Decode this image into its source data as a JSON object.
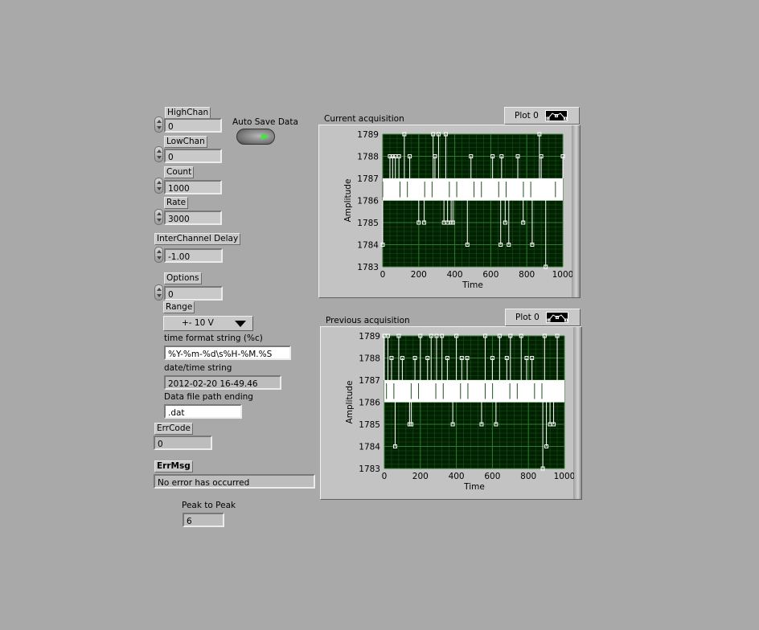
{
  "controls": {
    "high_chan": {
      "label": "HighChan",
      "value": "0"
    },
    "low_chan": {
      "label": "LowChan",
      "value": "0"
    },
    "count": {
      "label": "Count",
      "value": "1000"
    },
    "rate": {
      "label": "Rate",
      "value": "3000"
    },
    "interchannel_delay": {
      "label": "InterChannel Delay",
      "value": "-1.00"
    },
    "options": {
      "label": "Options",
      "value": "0"
    },
    "range": {
      "label": "Range",
      "value": "+- 10 V"
    },
    "time_format": {
      "label": "time format string (%c)",
      "value": "%Y-%m-%d\\s%H-%M.%S"
    },
    "datetime": {
      "label": "date/time string",
      "value": "2012-02-20 16-49.46"
    },
    "data_file_path": {
      "label": "Data file path ending",
      "value": ".dat"
    },
    "err_code": {
      "label": "ErrCode",
      "value": "0"
    },
    "err_msg": {
      "label": "ErrMsg",
      "value": "No error has occurred"
    },
    "peak_to_peak": {
      "label": "Peak to Peak",
      "value": "6"
    },
    "auto_save": {
      "label": "Auto Save Data",
      "state": "on",
      "led_color": "#3fe83f"
    }
  },
  "colors": {
    "panel_bg": "#a9a9a9",
    "plot_bg": "#002200",
    "grid": "#2f7a2f",
    "trace": "#ffffff"
  },
  "chart_data": [
    {
      "type": "line",
      "title": "Current acquisition",
      "xlabel": "Time",
      "ylabel": "Amplitude",
      "legend": "Plot 0",
      "xlim": [
        0,
        1000
      ],
      "ylim": [
        1783,
        1789
      ],
      "x_ticks": [
        "0",
        "200",
        "400",
        "600",
        "800",
        "1000"
      ],
      "y_ticks": [
        "1789",
        "1788",
        "1787",
        "1786",
        "1785",
        "1784",
        "1783"
      ],
      "series": [
        {
          "name": "Plot 0",
          "markers": [
            [
              0,
              1784
            ],
            [
              40,
              1788
            ],
            [
              55,
              1788
            ],
            [
              70,
              1788
            ],
            [
              90,
              1788
            ],
            [
              120,
              1789
            ],
            [
              150,
              1788
            ],
            [
              200,
              1785
            ],
            [
              230,
              1785
            ],
            [
              280,
              1789
            ],
            [
              290,
              1788
            ],
            [
              310,
              1789
            ],
            [
              340,
              1785
            ],
            [
              350,
              1789
            ],
            [
              360,
              1785
            ],
            [
              380,
              1785
            ],
            [
              390,
              1785
            ],
            [
              470,
              1784
            ],
            [
              490,
              1788
            ],
            [
              610,
              1788
            ],
            [
              655,
              1784
            ],
            [
              660,
              1788
            ],
            [
              680,
              1785
            ],
            [
              700,
              1784
            ],
            [
              750,
              1788
            ],
            [
              780,
              1785
            ],
            [
              830,
              1784
            ],
            [
              870,
              1789
            ],
            [
              880,
              1788
            ],
            [
              905,
              1783
            ],
            [
              1000,
              1788
            ]
          ],
          "band": {
            "y_low": 1786,
            "y_high": 1787,
            "x_from": 0,
            "x_to": 1000
          }
        }
      ]
    },
    {
      "type": "line",
      "title": "Previous acquisition",
      "xlabel": "Time",
      "ylabel": "Amplitude",
      "legend": "Plot 0",
      "xlim": [
        0,
        1000
      ],
      "ylim": [
        1783,
        1789
      ],
      "x_ticks": [
        "0",
        "200",
        "400",
        "600",
        "800",
        "1000"
      ],
      "y_ticks": [
        "1789",
        "1788",
        "1787",
        "1786",
        "1785",
        "1784",
        "1783"
      ],
      "series": [
        {
          "name": "Plot 0",
          "markers": [
            [
              0,
              1789
            ],
            [
              20,
              1789
            ],
            [
              40,
              1788
            ],
            [
              60,
              1784
            ],
            [
              80,
              1789
            ],
            [
              100,
              1788
            ],
            [
              140,
              1785
            ],
            [
              150,
              1785
            ],
            [
              170,
              1788
            ],
            [
              200,
              1789
            ],
            [
              240,
              1788
            ],
            [
              260,
              1789
            ],
            [
              290,
              1789
            ],
            [
              320,
              1789
            ],
            [
              350,
              1788
            ],
            [
              380,
              1785
            ],
            [
              400,
              1789
            ],
            [
              430,
              1788
            ],
            [
              460,
              1788
            ],
            [
              540,
              1785
            ],
            [
              560,
              1789
            ],
            [
              600,
              1788
            ],
            [
              620,
              1785
            ],
            [
              640,
              1789
            ],
            [
              680,
              1788
            ],
            [
              700,
              1789
            ],
            [
              760,
              1789
            ],
            [
              790,
              1788
            ],
            [
              820,
              1788
            ],
            [
              880,
              1783
            ],
            [
              890,
              1789
            ],
            [
              900,
              1784
            ],
            [
              920,
              1785
            ],
            [
              940,
              1785
            ],
            [
              960,
              1789
            ]
          ],
          "band": {
            "y_low": 1786,
            "y_high": 1787,
            "x_from": 0,
            "x_to": 1000
          }
        }
      ]
    }
  ]
}
